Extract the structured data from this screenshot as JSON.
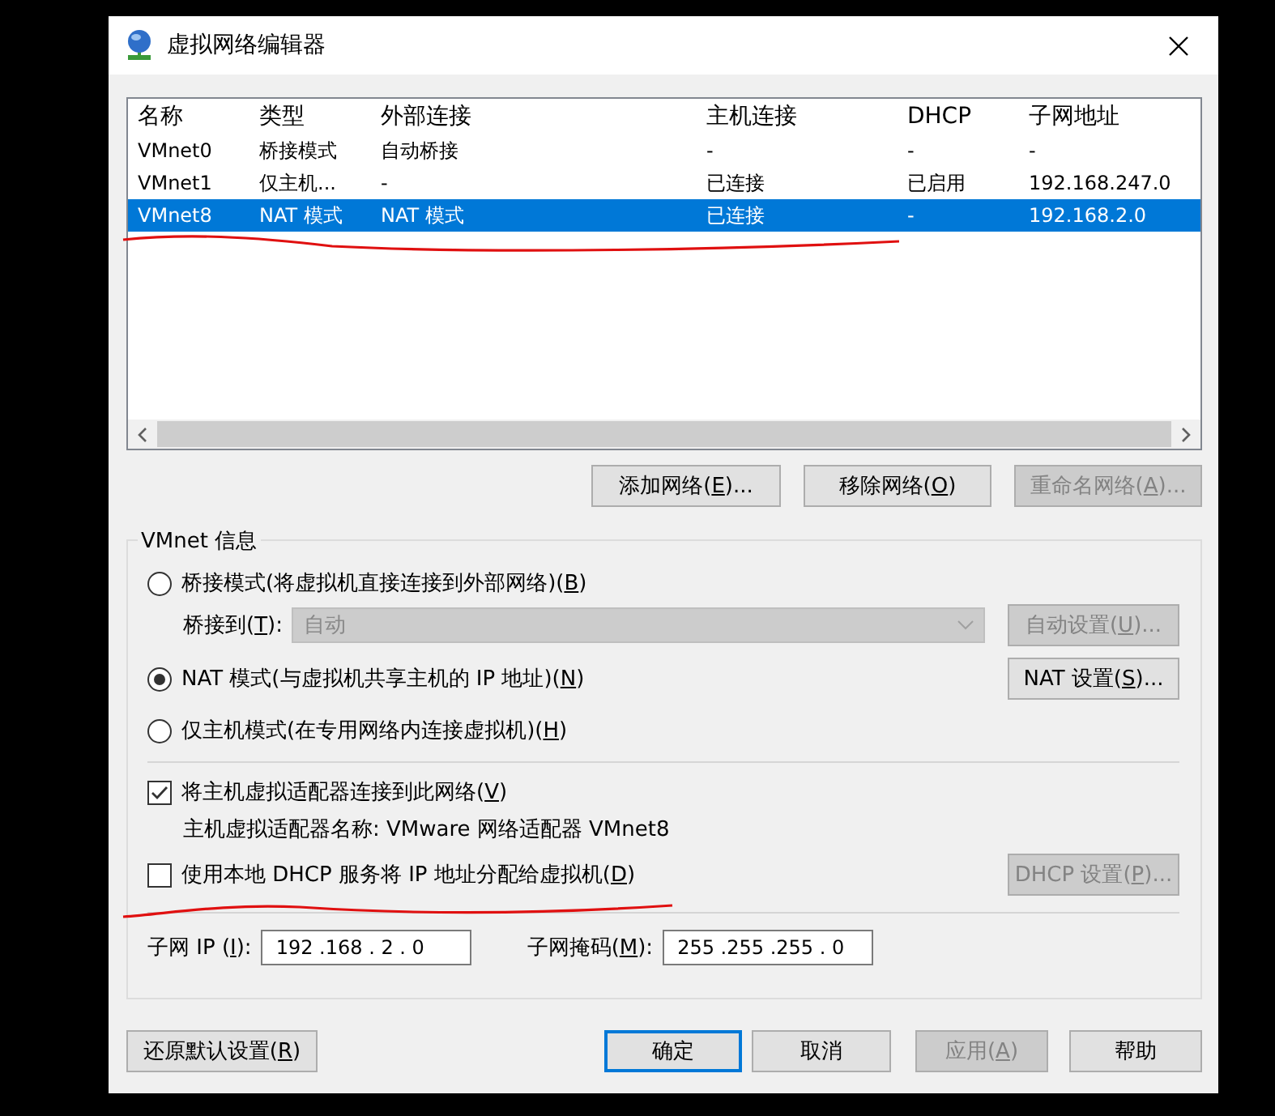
{
  "window": {
    "title": "虚拟网络编辑器"
  },
  "table": {
    "columns": [
      "名称",
      "类型",
      "外部连接",
      "主机连接",
      "DHCP",
      "子网地址"
    ],
    "rows": [
      {
        "cells": [
          "VMnet0",
          "桥接模式",
          "自动桥接",
          "-",
          "-",
          "-"
        ],
        "selected": false
      },
      {
        "cells": [
          "VMnet1",
          "仅主机...",
          "-",
          "已连接",
          "已启用",
          "192.168.247.0"
        ],
        "selected": false
      },
      {
        "cells": [
          "VMnet8",
          "NAT 模式",
          "NAT 模式",
          "已连接",
          "-",
          "192.168.2.0"
        ],
        "selected": true
      }
    ]
  },
  "list_buttons": [
    {
      "label": [
        "添加网络(",
        "E",
        ")..."
      ],
      "disabled": false
    },
    {
      "label": [
        "移除网络(",
        "O",
        ")"
      ],
      "disabled": false
    },
    {
      "label": [
        "重命名网络(",
        "A",
        ")..."
      ],
      "disabled": true
    }
  ],
  "vmnet_info": {
    "title": "VMnet 信息",
    "modes": [
      {
        "label": [
          "桥接模式(将虚拟机直接连接到外部网络)(",
          "B",
          ")"
        ],
        "selected": false
      },
      {
        "label": [
          "NAT 模式(与虚拟机共享主机的 IP 地址)(",
          "N",
          ")"
        ],
        "selected": true
      },
      {
        "label": [
          "仅主机模式(在专用网络内连接虚拟机)(",
          "H",
          ")"
        ],
        "selected": false
      }
    ],
    "bridge_to": {
      "label": [
        "桥接到(",
        "T",
        "):"
      ],
      "value": "自动",
      "disabled": true
    },
    "auto_settings_button": {
      "label": [
        "自动设置(",
        "U",
        ")..."
      ],
      "disabled": true
    },
    "nat_settings_button": {
      "label": [
        "NAT 设置(",
        "S",
        ")..."
      ],
      "disabled": false
    },
    "connect_adapter": {
      "label": [
        "将主机虚拟适配器连接到此网络(",
        "V",
        ")"
      ],
      "checked": true
    },
    "adapter_name": "主机虚拟适配器名称: VMware 网络适配器 VMnet8",
    "use_dhcp": {
      "label": [
        "使用本地 DHCP 服务将 IP 地址分配给虚拟机(",
        "D",
        ")"
      ],
      "checked": false
    },
    "dhcp_settings_button": {
      "label": [
        "DHCP 设置(",
        "P",
        ")..."
      ],
      "disabled": true
    },
    "subnet_ip": {
      "label": [
        "子网 IP (",
        "I",
        "):"
      ],
      "value": "192 .168 . 2 . 0"
    },
    "subnet_mask": {
      "label": [
        "子网掩码(",
        "M",
        "):"
      ],
      "value": "255 .255 .255 . 0"
    }
  },
  "footer_buttons": [
    {
      "label": [
        "还原默认设置(",
        "R",
        ")"
      ],
      "disabled": false,
      "default": false
    },
    {
      "label": [
        "确定"
      ],
      "disabled": false,
      "default": true
    },
    {
      "label": [
        "取消"
      ],
      "disabled": false,
      "default": false
    },
    {
      "label": [
        "应用(",
        "A",
        ")"
      ],
      "disabled": true,
      "default": false
    },
    {
      "label": [
        "帮助"
      ],
      "disabled": false,
      "default": false
    }
  ]
}
